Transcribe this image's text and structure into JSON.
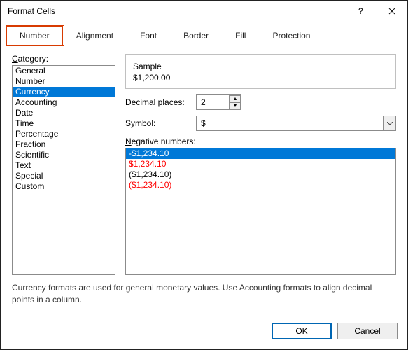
{
  "titlebar": {
    "title": "Format Cells"
  },
  "tabs": [
    {
      "label": "Number",
      "active": true
    },
    {
      "label": "Alignment",
      "active": false
    },
    {
      "label": "Font",
      "active": false
    },
    {
      "label": "Border",
      "active": false
    },
    {
      "label": "Fill",
      "active": false
    },
    {
      "label": "Protection",
      "active": false
    }
  ],
  "category": {
    "label": "Category:",
    "items": [
      {
        "label": "General"
      },
      {
        "label": "Number"
      },
      {
        "label": "Currency",
        "selected": true
      },
      {
        "label": "Accounting"
      },
      {
        "label": "Date"
      },
      {
        "label": "Time"
      },
      {
        "label": "Percentage"
      },
      {
        "label": "Fraction"
      },
      {
        "label": "Scientific"
      },
      {
        "label": "Text"
      },
      {
        "label": "Special"
      },
      {
        "label": "Custom"
      }
    ]
  },
  "sample": {
    "label": "Sample",
    "value": "$1,200.00"
  },
  "decimal": {
    "label": "Decimal places:",
    "value": "2"
  },
  "symbol": {
    "label": "Symbol:",
    "value": "$"
  },
  "negative": {
    "label": "Negative numbers:",
    "items": [
      {
        "text": "-$1,234.10",
        "color": "#000000",
        "selected": true
      },
      {
        "text": "$1,234.10",
        "color": "#ff0000"
      },
      {
        "text": "($1,234.10)",
        "color": "#000000"
      },
      {
        "text": "($1,234.10)",
        "color": "#ff0000"
      }
    ]
  },
  "description": "Currency formats are used for general monetary values.  Use Accounting formats to align decimal points in a column.",
  "buttons": {
    "ok": "OK",
    "cancel": "Cancel"
  },
  "colors": {
    "highlight_tab_outline": "#d83b01",
    "selection_bg": "#0078d7"
  }
}
